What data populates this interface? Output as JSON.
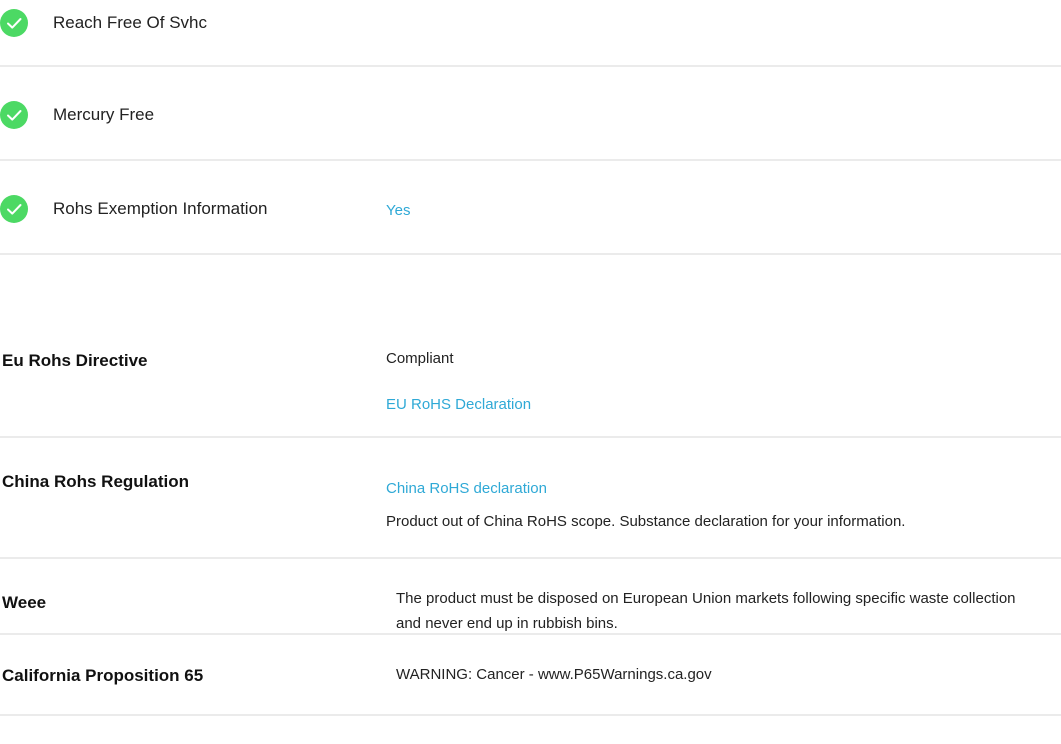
{
  "checks": [
    {
      "label": "Reach Free Of Svhc",
      "icon": "check-circle-icon"
    },
    {
      "label": "Mercury Free",
      "icon": "check-circle-icon"
    },
    {
      "label": "Rohs Exemption Information",
      "value": "Yes",
      "icon": "check-circle-icon"
    }
  ],
  "compliance": {
    "eu_rohs": {
      "label": "Eu Rohs Directive",
      "status": "Compliant",
      "link": "EU RoHS Declaration"
    },
    "china_rohs": {
      "label": "China Rohs Regulation",
      "link": "China RoHS declaration",
      "note": "Product out of China RoHS scope. Substance declaration for your information."
    },
    "weee": {
      "label": "Weee",
      "text": "The product must be disposed on European Union markets following specific waste collection and never end up in rubbish bins."
    },
    "prop65": {
      "label": "California Proposition 65",
      "text": "WARNING: Cancer - www.P65Warnings.ca.gov"
    }
  },
  "colors": {
    "check_green": "#4cd964",
    "link_blue": "#2fa9d6",
    "divider": "#ebebeb"
  }
}
